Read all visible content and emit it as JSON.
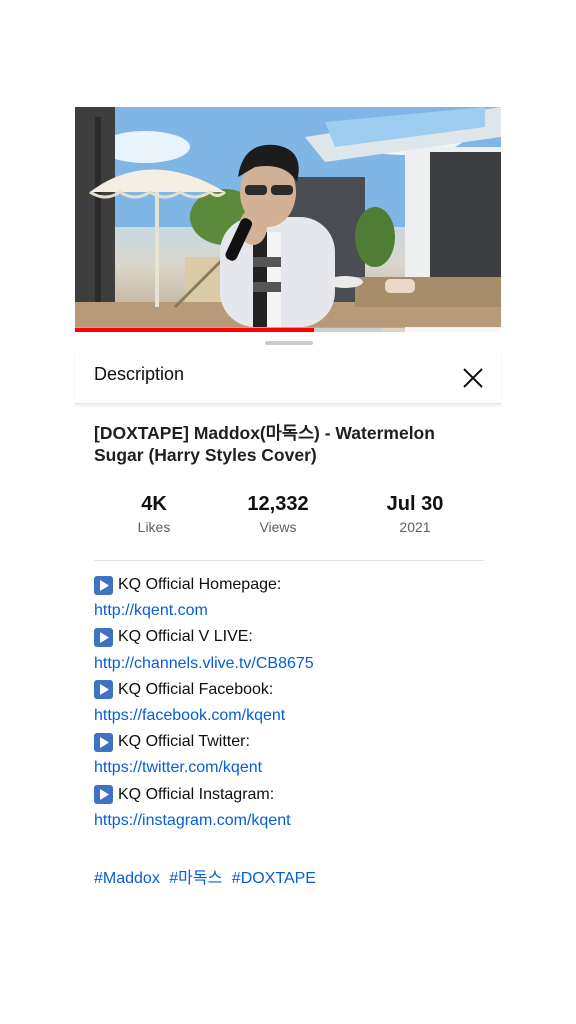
{
  "video": {
    "progress_fraction": 0.56,
    "buffer_fraction": 0.72
  },
  "sheet": {
    "title": "Description",
    "close_icon": "close-icon"
  },
  "details": {
    "video_title": "[DOXTAPE] Maddox(마독스) - Watermelon Sugar (Harry Styles Cover)",
    "stats": [
      {
        "value": "4K",
        "label": "Likes"
      },
      {
        "value": "12,332",
        "label": "Views"
      },
      {
        "value": "Jul 30",
        "label": "2021"
      }
    ]
  },
  "description": {
    "lines": [
      {
        "type": "text",
        "icon": "play-button-icon",
        "text": "KQ Official Homepage:"
      },
      {
        "type": "link",
        "text": "http://kqent.com"
      },
      {
        "type": "text",
        "icon": "play-button-icon",
        "text": "KQ Official V LIVE:"
      },
      {
        "type": "link",
        "text": "http://channels.vlive.tv/CB8675"
      },
      {
        "type": "text",
        "icon": "play-button-icon",
        "text": "KQ Official Facebook:"
      },
      {
        "type": "link",
        "text": "https://facebook.com/kqent"
      },
      {
        "type": "text",
        "icon": "play-button-icon",
        "text": "KQ Official Twitter:"
      },
      {
        "type": "link",
        "text": "https://twitter.com/kqent"
      },
      {
        "type": "text",
        "icon": "play-button-icon",
        "text": "KQ Official Instagram:"
      },
      {
        "type": "link",
        "text": "https://instagram.com/kqent"
      }
    ],
    "hashtags": [
      "#Maddox",
      "#마독스",
      "#DOXTAPE"
    ]
  },
  "colors": {
    "link": "#065fd4",
    "progress": "#ff0000"
  }
}
